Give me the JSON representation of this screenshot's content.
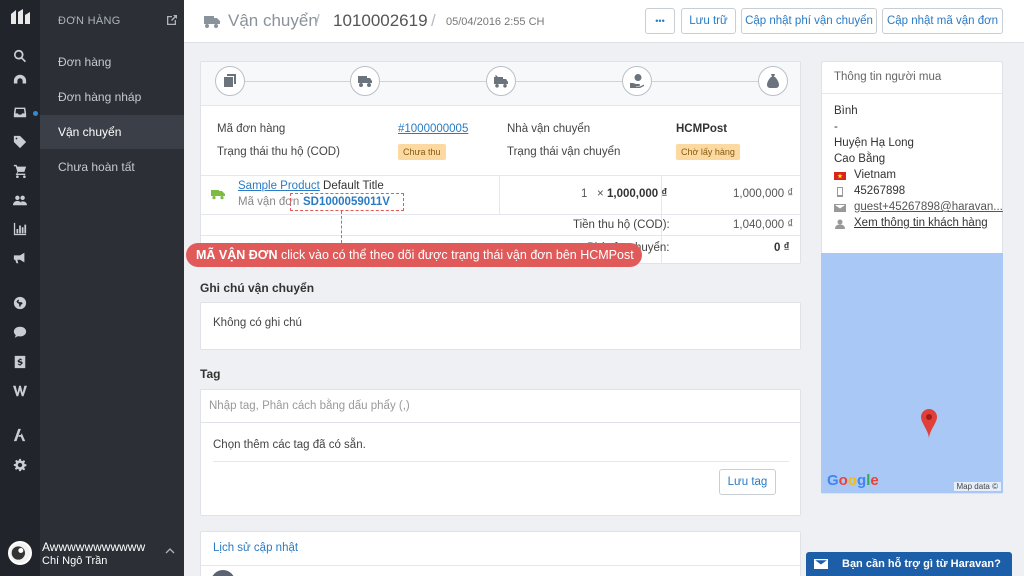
{
  "sidebar": {
    "header": "ĐƠN HÀNG",
    "items": [
      {
        "label": "Đơn hàng"
      },
      {
        "label": "Đơn hàng nháp"
      },
      {
        "label": "Vận chuyển"
      },
      {
        "label": "Chưa hoàn tất"
      }
    ],
    "user": {
      "shop": "Awwwwwwwwwww",
      "name": "Chí Ngô Trần"
    }
  },
  "topbar": {
    "section": "Vận chuyển",
    "separator": "/",
    "shipment_id": "1010002619",
    "date": "05/04/2016 2:55 CH",
    "more_label": "•••",
    "archive_label": "Lưu trữ",
    "update_fee_label": "Cập nhật phí vận chuyển",
    "update_code_label": "Cập nhật mã vận đơn"
  },
  "shipment": {
    "order_code_label": "Mã đơn hàng",
    "order_code": "#1000000005",
    "cod_status_label": "Trạng thái thu hộ (COD)",
    "cod_status": "Chưa thu",
    "carrier_label": "Nhà vận chuyển",
    "carrier": "HCMPost",
    "ship_status_label": "Trạng thái vận chuyển",
    "ship_status": "Chờ lấy hàng"
  },
  "line_item": {
    "product": "Sample Product",
    "variant": "Default Title",
    "tracking_label": "Mã vận đơn",
    "tracking_code": "SD1000059011V",
    "qty": "1",
    "times": "×",
    "price": "1,000,000 ₫",
    "total": "1,000,000 ₫"
  },
  "totals": {
    "cod_label": "Tiền thu hộ (COD):",
    "cod_value": "1,040,000 ₫",
    "ship_label": "Phí vận chuyển:",
    "ship_value": "0 ₫"
  },
  "callout": {
    "bold": "MÃ VẬN ĐƠN",
    "text": " click vào có thể theo dõi được trạng thái vận đơn bên HCMPost"
  },
  "notes": {
    "title": "Ghi chú vận chuyển",
    "text": "Không có ghi chú"
  },
  "tags": {
    "title": "Tag",
    "placeholder": "Nhập tag, Phân cách bằng dấu phẩy (,)",
    "choose_text": "Chọn thêm các tag đã có sẵn.",
    "save_label": "Lưu tag"
  },
  "history": {
    "title": "Lịch sử cập nhật"
  },
  "buyer": {
    "header": "Thông tin người mua",
    "name": "Bình",
    "dash": "-",
    "district": "Huyện Hạ Long",
    "province": "Cao Bằng",
    "country": "Vietnam",
    "phone": "45267898",
    "email": "guest+45267898@haravan...",
    "view_link": "Xem thông tin khách hàng"
  },
  "map": {
    "logo": "Google",
    "attribution": "Map data ©"
  },
  "help": {
    "label": "Bạn cần hỗ trợ gì từ Haravan?"
  }
}
